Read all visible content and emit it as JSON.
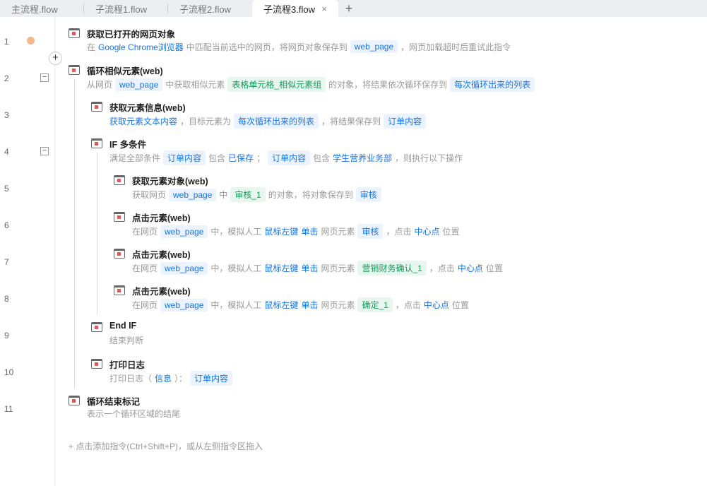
{
  "tabs": [
    {
      "label": "主流程.flow"
    },
    {
      "label": "子流程1.flow"
    },
    {
      "label": "子流程2.flow"
    },
    {
      "label": "子流程3.flow",
      "close": "×"
    }
  ],
  "add_tab": "+",
  "rows": [
    {
      "n": "1",
      "title": "获取已打开的网页对象",
      "desc": [
        {
          "t": "在",
          "k": "text"
        },
        {
          "t": "Google Chrome浏览器",
          "k": "link"
        },
        {
          "t": "中匹配当前选中的网页，将网页对象保存到",
          "k": "text"
        },
        {
          "t": "web_page",
          "k": "chip"
        },
        {
          "t": "，网页加载超时后重试此指令",
          "k": "text"
        }
      ]
    },
    {
      "n": "2",
      "title": "循环相似元素(web)",
      "desc": [
        {
          "t": "从网页",
          "k": "text"
        },
        {
          "t": "web_page",
          "k": "chip"
        },
        {
          "t": "中获取相似元素",
          "k": "text"
        },
        {
          "t": "表格单元格_相似元素组",
          "k": "chipg"
        },
        {
          "t": "的对象，将结果依次循环保存到",
          "k": "text"
        },
        {
          "t": "每次循环出来的列表",
          "k": "chip"
        }
      ]
    },
    {
      "n": "3",
      "title": "获取元素信息(web)",
      "desc": [
        {
          "t": "获取元素文本内容",
          "k": "link"
        },
        {
          "t": "，目标元素为",
          "k": "text"
        },
        {
          "t": "每次循环出来的列表",
          "k": "chip"
        },
        {
          "t": "，将结果保存到",
          "k": "text"
        },
        {
          "t": "订单内容",
          "k": "chip"
        }
      ]
    },
    {
      "n": "4",
      "title": "IF 多条件",
      "desc": [
        {
          "t": "满足全部条件",
          "k": "text"
        },
        {
          "t": "订单内容",
          "k": "chip"
        },
        {
          "t": "包含",
          "k": "text"
        },
        {
          "t": "已保存",
          "k": "link"
        },
        {
          "t": "；",
          "k": "text"
        },
        {
          "t": "订单内容",
          "k": "chip"
        },
        {
          "t": "包含",
          "k": "text"
        },
        {
          "t": "学生营养业务部",
          "k": "link"
        },
        {
          "t": "，则执行以下操作",
          "k": "text"
        }
      ]
    },
    {
      "n": "5",
      "title": "获取元素对象(web)",
      "desc": [
        {
          "t": "获取网页",
          "k": "text"
        },
        {
          "t": "web_page",
          "k": "chip"
        },
        {
          "t": "中",
          "k": "text"
        },
        {
          "t": "审核_1",
          "k": "chipg"
        },
        {
          "t": "的对象，将对象保存到",
          "k": "text"
        },
        {
          "t": "审核",
          "k": "chip"
        }
      ]
    },
    {
      "n": "6",
      "title": "点击元素(web)",
      "desc": [
        {
          "t": "在网页",
          "k": "text"
        },
        {
          "t": "web_page",
          "k": "chip"
        },
        {
          "t": "中，模拟人工",
          "k": "text"
        },
        {
          "t": "鼠标左键",
          "k": "link"
        },
        {
          "t": "单击",
          "k": "link"
        },
        {
          "t": "网页元素",
          "k": "text"
        },
        {
          "t": "审核",
          "k": "chip"
        },
        {
          "t": "，点击",
          "k": "text"
        },
        {
          "t": "中心点",
          "k": "link"
        },
        {
          "t": "位置",
          "k": "text"
        }
      ]
    },
    {
      "n": "7",
      "title": "点击元素(web)",
      "desc": [
        {
          "t": "在网页",
          "k": "text"
        },
        {
          "t": "web_page",
          "k": "chip"
        },
        {
          "t": "中，模拟人工",
          "k": "text"
        },
        {
          "t": "鼠标左键",
          "k": "link"
        },
        {
          "t": "单击",
          "k": "link"
        },
        {
          "t": "网页元素",
          "k": "text"
        },
        {
          "t": "营销财务确认_1",
          "k": "chipg"
        },
        {
          "t": "，点击",
          "k": "text"
        },
        {
          "t": "中心点",
          "k": "link"
        },
        {
          "t": "位置",
          "k": "text"
        }
      ]
    },
    {
      "n": "8",
      "title": "点击元素(web)",
      "desc": [
        {
          "t": "在网页",
          "k": "text"
        },
        {
          "t": "web_page",
          "k": "chip"
        },
        {
          "t": "中，模拟人工",
          "k": "text"
        },
        {
          "t": "鼠标左键",
          "k": "link"
        },
        {
          "t": "单击",
          "k": "link"
        },
        {
          "t": "网页元素",
          "k": "text"
        },
        {
          "t": "确定_1",
          "k": "chipg"
        },
        {
          "t": "，点击",
          "k": "text"
        },
        {
          "t": "中心点",
          "k": "link"
        },
        {
          "t": "位置",
          "k": "text"
        }
      ]
    },
    {
      "n": "9",
      "title": "End IF",
      "desc": [
        {
          "t": "结束判断",
          "k": "text"
        }
      ]
    },
    {
      "n": "10",
      "title": "打印日志",
      "desc": [
        {
          "t": "打印日志（",
          "k": "text"
        },
        {
          "t": "信息",
          "k": "link"
        },
        {
          "t": "）：",
          "k": "text"
        },
        {
          "t": "订单内容",
          "k": "chip"
        }
      ]
    },
    {
      "n": "11",
      "title": "循环结束标记",
      "desc": [
        {
          "t": "表示一个循环区域的结尾",
          "k": "text"
        }
      ]
    }
  ],
  "footer": "+  点击添加指令(Ctrl+Shift+P)，或从左侧指令区拖入",
  "colors": {
    "link": "#1a73e8",
    "chip_green": "#1a9b5c",
    "breakpoint": "#f4b78e"
  }
}
